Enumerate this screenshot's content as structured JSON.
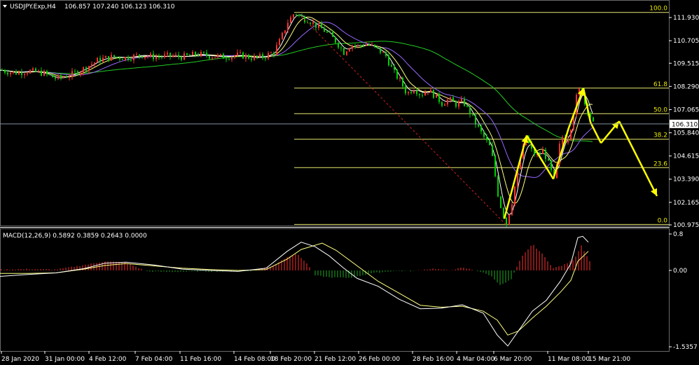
{
  "header": {
    "symbol_label": "USDJPY.Exp,H4",
    "ohlc": "106.857 107.240 106.123 106.310",
    "dropdown_icon": "triangle-down-icon"
  },
  "colors": {
    "background": "#000000",
    "bull_candle": "#ff3030",
    "bear_candle": "#00d000",
    "fib_line": "#e8e870",
    "fib_text": "#e8e800",
    "ma_fast": "#ffffff",
    "ma_mid": "#ffff80",
    "ma_slow": "#9966ff",
    "ma_long": "#22cc22",
    "arrows": "#ffff00",
    "trend_dash": "#cc2020",
    "macd_pos": "#ff3030",
    "macd_neg": "#22aa22",
    "macd_signal": "#ffff80",
    "macd_main": "#ffffff",
    "price_line": "#8090a0",
    "axis_text": "#ffffff"
  },
  "chart_data": [
    {
      "type": "candlestick",
      "title": "USDJPY.Exp,H4",
      "ylim": [
        100.975,
        112.4
      ],
      "price_axis_ticks": [
        "111.930",
        "110.705",
        "109.515",
        "108.290",
        "107.065",
        "105.840",
        "104.615",
        "103.390",
        "102.165",
        "100.975"
      ],
      "current_price": "106.310",
      "time_axis_labels": [
        "28 Jan 2020",
        "31 Jan 00:00",
        "4 Feb 12:00",
        "7 Feb 04:00",
        "11 Feb 16:00",
        "14 Feb 08:00",
        "18 Feb 20:00",
        "21 Feb 12:00",
        "26 Feb 00:00",
        "28 Feb 16:00",
        "4 Mar 04:00",
        "6 Mar 20:00",
        "11 Mar 08:00",
        "15 Mar 21:00"
      ],
      "fibonacci_levels": [
        {
          "label": "100.0",
          "price": 112.2
        },
        {
          "label": "61.8",
          "price": 108.2
        },
        {
          "label": "50.0",
          "price": 106.85
        },
        {
          "label": "38.2",
          "price": 105.5
        },
        {
          "label": "23.6",
          "price": 104.0
        },
        {
          "label": "0.0",
          "price": 101.0
        }
      ],
      "price_path": [
        [
          0,
          109.15
        ],
        [
          20,
          109.0
        ],
        [
          40,
          109.1
        ],
        [
          60,
          109.0
        ],
        [
          80,
          108.7
        ],
        [
          100,
          108.9
        ],
        [
          120,
          109.25
        ],
        [
          140,
          109.7
        ],
        [
          160,
          109.85
        ],
        [
          180,
          109.8
        ],
        [
          200,
          109.95
        ],
        [
          220,
          109.85
        ],
        [
          240,
          109.9
        ],
        [
          260,
          109.85
        ],
        [
          280,
          110.0
        ],
        [
          300,
          109.9
        ],
        [
          320,
          109.85
        ],
        [
          340,
          109.95
        ],
        [
          360,
          109.8
        ],
        [
          375,
          109.85
        ],
        [
          390,
          110.1
        ],
        [
          400,
          110.8
        ],
        [
          410,
          111.7
        ],
        [
          420,
          112.2
        ],
        [
          430,
          111.9
        ],
        [
          440,
          111.8
        ],
        [
          450,
          111.5
        ],
        [
          460,
          111.3
        ],
        [
          470,
          111.0
        ],
        [
          480,
          110.6
        ],
        [
          490,
          110.1
        ],
        [
          500,
          110.5
        ],
        [
          510,
          110.4
        ],
        [
          520,
          110.55
        ],
        [
          530,
          110.4
        ],
        [
          540,
          110.2
        ],
        [
          550,
          109.9
        ],
        [
          560,
          109.1
        ],
        [
          570,
          108.6
        ],
        [
          580,
          107.9
        ],
        [
          590,
          108.2
        ],
        [
          600,
          107.85
        ],
        [
          610,
          108.1
        ],
        [
          620,
          107.8
        ],
        [
          630,
          107.4
        ],
        [
          640,
          107.6
        ],
        [
          650,
          107.35
        ],
        [
          660,
          107.5
        ],
        [
          670,
          106.9
        ],
        [
          680,
          106.2
        ],
        [
          690,
          105.6
        ],
        [
          700,
          105.0
        ],
        [
          710,
          102.6
        ],
        [
          715,
          101.8
        ],
        [
          722,
          101.05
        ],
        [
          730,
          102.2
        ],
        [
          740,
          104.2
        ],
        [
          750,
          105.6
        ],
        [
          758,
          104.9
        ],
        [
          765,
          104.6
        ],
        [
          775,
          104.9
        ],
        [
          785,
          103.9
        ],
        [
          790,
          103.3
        ],
        [
          795,
          104.3
        ],
        [
          800,
          105.7
        ],
        [
          808,
          105.4
        ],
        [
          815,
          106.3
        ],
        [
          822,
          107.7
        ],
        [
          828,
          108.3
        ],
        [
          834,
          107.4
        ],
        [
          840,
          106.9
        ],
        [
          846,
          106.31
        ]
      ],
      "arrow_path": [
        [
          720,
          101.3
        ],
        [
          752,
          105.7
        ],
        [
          790,
          103.4
        ],
        [
          812,
          106.1
        ],
        [
          833,
          108.2
        ],
        [
          843,
          106.4
        ],
        [
          858,
          105.3
        ],
        [
          884,
          106.45
        ],
        [
          938,
          102.5
        ]
      ],
      "trend_line": [
        [
          430,
          112.0
        ],
        [
          722,
          101.0
        ]
      ]
    },
    {
      "type": "histogram",
      "title": "MACD(12,26,9) 0.5892 0.3859 0.2643 0.0000",
      "ylim": [
        -1.5357,
        0.8
      ],
      "axis_labels": [
        "0.8",
        "0.00",
        "-1.5357"
      ],
      "histogram": [
        [
          0,
          0.02
        ],
        [
          40,
          0.03
        ],
        [
          80,
          0.02
        ],
        [
          120,
          0.12
        ],
        [
          150,
          0.2
        ],
        [
          180,
          0.17
        ],
        [
          210,
          -0.02
        ],
        [
          240,
          -0.03
        ],
        [
          280,
          -0.02
        ],
        [
          320,
          -0.02
        ],
        [
          360,
          -0.01
        ],
        [
          390,
          0.1
        ],
        [
          410,
          0.3
        ],
        [
          425,
          0.36
        ],
        [
          440,
          0.12
        ],
        [
          450,
          -0.1
        ],
        [
          470,
          -0.14
        ],
        [
          500,
          -0.15
        ],
        [
          530,
          -0.06
        ],
        [
          560,
          -0.01
        ],
        [
          590,
          -0.01
        ],
        [
          600,
          0.01
        ],
        [
          620,
          0.04
        ],
        [
          640,
          0.0
        ],
        [
          660,
          0.06
        ],
        [
          680,
          0.0
        ],
        [
          700,
          -0.1
        ],
        [
          715,
          -0.3
        ],
        [
          730,
          -0.18
        ],
        [
          745,
          0.3
        ],
        [
          760,
          0.58
        ],
        [
          775,
          0.35
        ],
        [
          790,
          0.05
        ],
        [
          805,
          0.12
        ],
        [
          820,
          0.25
        ],
        [
          830,
          0.55
        ],
        [
          842,
          0.2
        ]
      ],
      "macd_main": [
        [
          0,
          -0.12
        ],
        [
          40,
          -0.08
        ],
        [
          80,
          -0.05
        ],
        [
          120,
          0.04
        ],
        [
          150,
          0.16
        ],
        [
          180,
          0.18
        ],
        [
          220,
          0.12
        ],
        [
          260,
          0.03
        ],
        [
          300,
          0.0
        ],
        [
          340,
          -0.02
        ],
        [
          380,
          0.05
        ],
        [
          410,
          0.42
        ],
        [
          430,
          0.62
        ],
        [
          450,
          0.52
        ],
        [
          470,
          0.32
        ],
        [
          490,
          0.06
        ],
        [
          510,
          -0.16
        ],
        [
          540,
          -0.32
        ],
        [
          570,
          -0.58
        ],
        [
          600,
          -0.77
        ],
        [
          630,
          -0.76
        ],
        [
          660,
          -0.69
        ],
        [
          690,
          -0.86
        ],
        [
          710,
          -1.3
        ],
        [
          725,
          -1.52
        ],
        [
          740,
          -1.22
        ],
        [
          760,
          -0.82
        ],
        [
          780,
          -0.6
        ],
        [
          800,
          -0.22
        ],
        [
          815,
          0.15
        ],
        [
          825,
          0.72
        ],
        [
          832,
          0.75
        ],
        [
          840,
          0.62
        ]
      ],
      "macd_signal": [
        [
          0,
          -0.06
        ],
        [
          40,
          -0.06
        ],
        [
          80,
          -0.05
        ],
        [
          120,
          0.03
        ],
        [
          150,
          0.11
        ],
        [
          180,
          0.15
        ],
        [
          220,
          0.1
        ],
        [
          260,
          0.05
        ],
        [
          300,
          0.02
        ],
        [
          340,
          0.0
        ],
        [
          380,
          0.02
        ],
        [
          410,
          0.25
        ],
        [
          430,
          0.46
        ],
        [
          460,
          0.6
        ],
        [
          480,
          0.44
        ],
        [
          510,
          0.1
        ],
        [
          540,
          -0.22
        ],
        [
          570,
          -0.46
        ],
        [
          600,
          -0.7
        ],
        [
          630,
          -0.74
        ],
        [
          660,
          -0.72
        ],
        [
          690,
          -0.82
        ],
        [
          710,
          -1.0
        ],
        [
          725,
          -1.3
        ],
        [
          740,
          -1.22
        ],
        [
          760,
          -0.96
        ],
        [
          780,
          -0.72
        ],
        [
          800,
          -0.44
        ],
        [
          815,
          -0.2
        ],
        [
          825,
          0.2
        ],
        [
          840,
          0.42
        ]
      ]
    }
  ]
}
